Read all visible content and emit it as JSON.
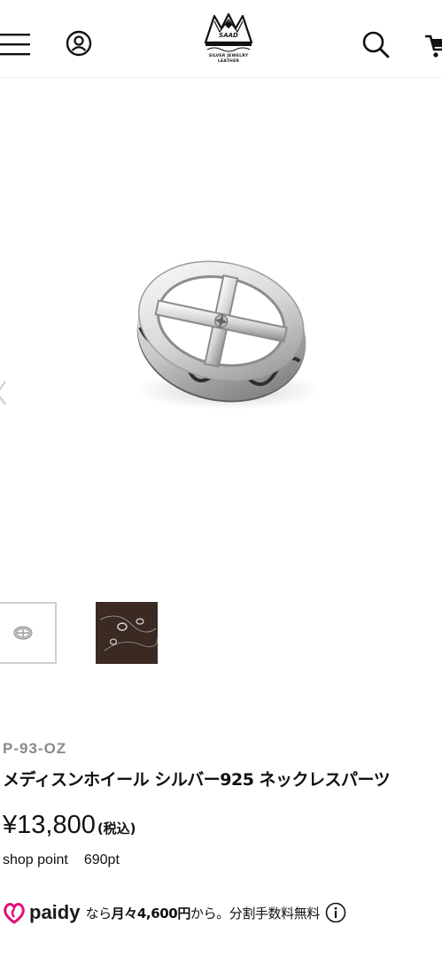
{
  "header": {
    "logo_name": "SAAD",
    "logo_sub1": "SILVER JEWELRY",
    "logo_sub2": "LEATHER",
    "icons": [
      "menu-icon",
      "user-icon",
      "search-icon",
      "cart-icon"
    ]
  },
  "product": {
    "sku": "P-93-OZ",
    "title": "メディスンホイール シルバー925 ネックレスパーツ",
    "price": "¥13,800",
    "tax_label": "(税込)",
    "points_label": "shop point",
    "points_value": "690pt"
  },
  "paidy": {
    "brand": "paidy",
    "text_prefix": "なら",
    "text_monthly": "月々4,600円",
    "text_suffix": "から。分割手数料無料"
  },
  "thumbnails": [
    "product-front",
    "product-lifestyle"
  ],
  "colors": {
    "accent_paidy": "#e0127a",
    "text": "#111111",
    "sku_gray": "#8a8a8a"
  }
}
